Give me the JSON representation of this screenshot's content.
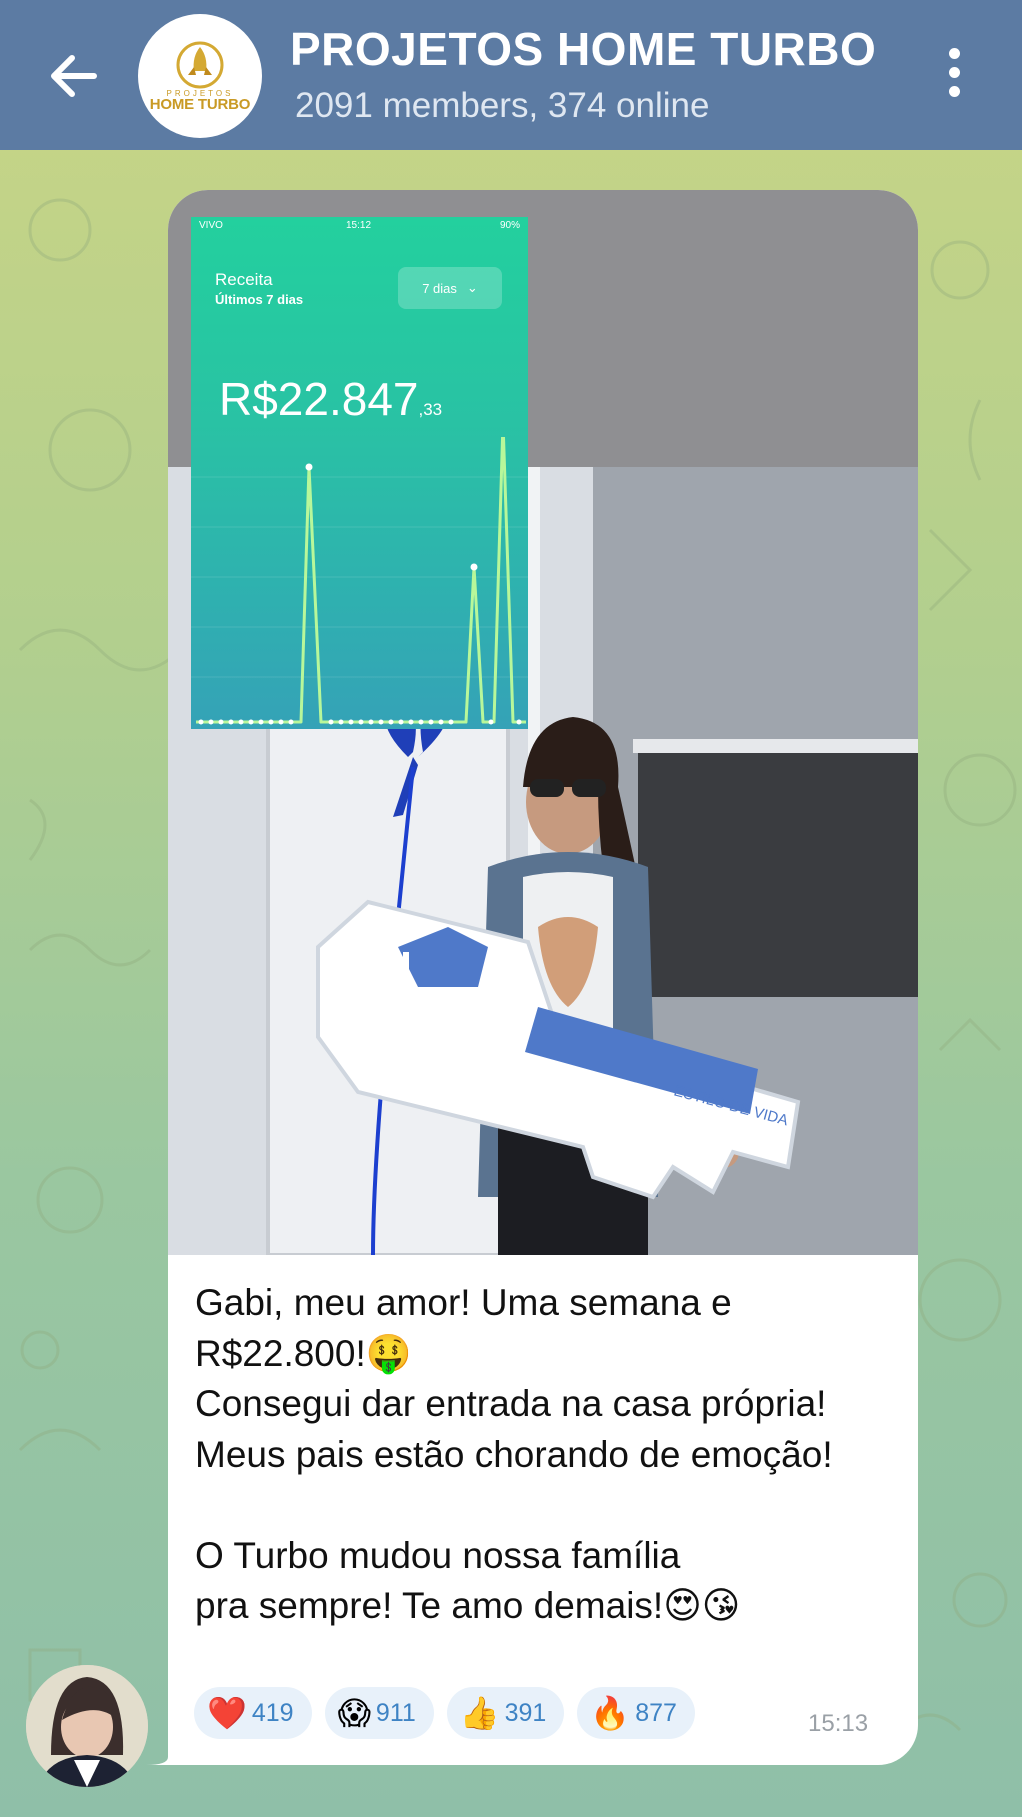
{
  "header": {
    "title": "PROJETOS HOME TURBO",
    "subtitle": "2091 members, 374 online",
    "avatar_logo_top": "PROJETOS",
    "avatar_logo_main": "HOME TURBO"
  },
  "message": {
    "image": {
      "app_screenshot": {
        "status_carrier": "VIVO",
        "status_time": "15:12",
        "status_battery": "90%",
        "label": "Receita",
        "sublabel": "Últimos 7 dias",
        "period_button": "7 dias",
        "amount_main": "R$22.847",
        "amount_cents": ",33"
      },
      "key_text": "ESTILO DE VIDA"
    },
    "caption": "Gabi, meu amor! Uma semana e\nR$22.800!🤑\nConsegui dar entrada na casa própria!\nMeus pais estão chorando de emoção!\n\nO Turbo mudou nossa família\npra sempre! Te amo demais!😍😘",
    "reactions": [
      {
        "emoji": "❤️",
        "count": "419"
      },
      {
        "emoji": "😱",
        "count": "911"
      },
      {
        "emoji": "👍",
        "count": "391"
      },
      {
        "emoji": "🔥",
        "count": "877"
      }
    ],
    "time": "15:13"
  },
  "colors": {
    "header_bg": "#5c7ba3",
    "reaction_bg": "#e8f1fa",
    "reaction_count": "#3e83c4",
    "chart_line": "#b8f79a",
    "app_gradient_top": "#23d09e",
    "app_gradient_bottom": "#35a2b7"
  },
  "icons": {
    "back": "arrow-left-icon",
    "menu": "more-vertical-icon"
  }
}
